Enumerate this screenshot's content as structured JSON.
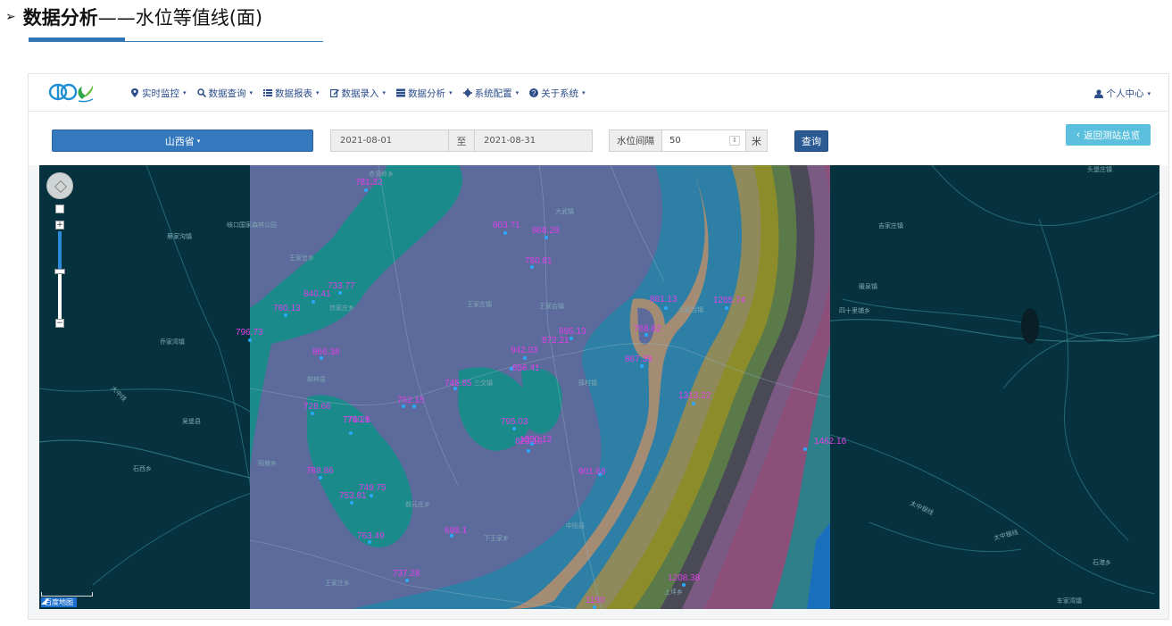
{
  "doc": {
    "arrow": "➢",
    "title_bold": "数据分析",
    "title_rest": "——水位等值线(面)"
  },
  "nav": {
    "items": [
      {
        "label": "实时监控",
        "icon": "map-marker-icon"
      },
      {
        "label": "数据查询",
        "icon": "search-icon"
      },
      {
        "label": "数据报表",
        "icon": "list-icon"
      },
      {
        "label": "数据录入",
        "icon": "edit-icon"
      },
      {
        "label": "数据分析",
        "icon": "server-icon"
      },
      {
        "label": "系统配置",
        "icon": "gear-icon"
      },
      {
        "label": "关于系统",
        "icon": "question-icon"
      }
    ],
    "user": "个人中心"
  },
  "toolbar": {
    "province": "山西省",
    "date_start": "2021-08-01",
    "date_sep": "至",
    "date_end": "2021-08-31",
    "level_label": "水位间隔",
    "level_value": "50",
    "level_unit": "米",
    "query": "查询",
    "back": "返回测站总览"
  },
  "map": {
    "brand": "百度地图",
    "places": [
      "蔡家沟镇",
      "岐口国家森林公园",
      "王家岔乡",
      "王家庄镇",
      "信家庄乡",
      "赤坚岭乡",
      "石西乡",
      "吴城乡",
      "吴堡县",
      "阳坡乡",
      "乔家湾镇",
      "柳林县",
      "三交镇",
      "王家会镇",
      "前元庄乡",
      "下王家乡",
      "薛村镇",
      "上坪乡",
      "中阳县",
      "宁乡镇",
      "大武镇",
      "北武当镇",
      "吉家庄镇",
      "暖泉镇",
      "四十里铺乡",
      "头堡庄镇",
      "车家湾镇",
      "石港乡",
      "阳泉曲镇",
      "南家坪",
      "王家庄乡",
      "大中线",
      "信家庄镇",
      "太中银线"
    ],
    "stations": [
      "781.32",
      "803.71",
      "868.29",
      "780.81",
      "796.73",
      "840.41",
      "733.77",
      "760.13",
      "866.38",
      "942.03",
      "895.13",
      "1265.74",
      "881.13",
      "768.82",
      "867.39",
      "856.41",
      "1313.22",
      "745.85",
      "762.15",
      "728.66",
      "774.26",
      "795.03",
      "823.16",
      "1462.16",
      "788.86",
      "753.81",
      "749.75",
      "901.68",
      "763.49",
      "737.28",
      "698.1",
      "1050.12",
      "790.1",
      "872.21",
      "1208.38",
      "1150"
    ]
  }
}
